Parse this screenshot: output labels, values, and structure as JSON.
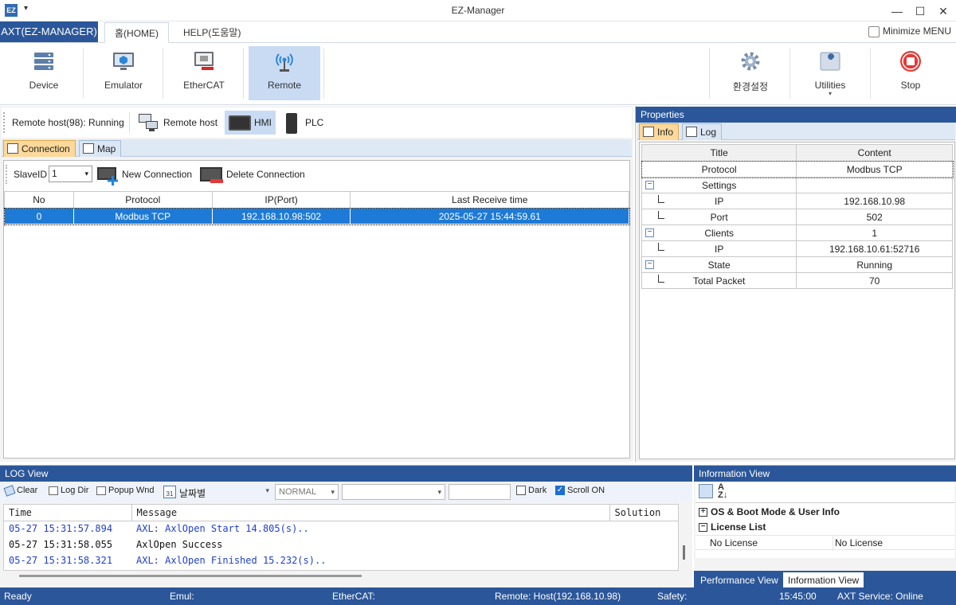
{
  "window": {
    "app_icon": "EZ",
    "title": "EZ-Manager",
    "minimize_glyph": "—",
    "maximize_glyph": "☐",
    "close_glyph": "✕"
  },
  "ribbon_tabs": {
    "app_menu": "AXT(EZ-MANAGER)",
    "home": "홈(HOME)",
    "help": "HELP(도움말)",
    "minimize_menu": "Minimize MENU"
  },
  "ribbon": {
    "device": "Device",
    "emulator": "Emulator",
    "ethercat": "EtherCAT",
    "remote": "Remote",
    "settings": "환경설정",
    "utilities": "Utilities",
    "stop": "Stop"
  },
  "remote_bar": {
    "status": "Remote host(98): Running",
    "remote_host": "Remote host",
    "hmi": "HMI",
    "plc": "PLC"
  },
  "panel_tabs": {
    "connection": "Connection",
    "map": "Map"
  },
  "connection": {
    "slave_label": "SlaveID",
    "slave_value": "1",
    "new_connection": "New Connection",
    "delete_connection": "Delete Connection",
    "columns": [
      "No",
      "Protocol",
      "IP(Port)",
      "Last Receive time"
    ],
    "rows": [
      [
        "0",
        "Modbus TCP",
        "192.168.10.98:502",
        "2025-05-27 15:44:59.61"
      ]
    ]
  },
  "properties": {
    "title": "Properties",
    "tab_info": "Info",
    "tab_log": "Log",
    "columns": [
      "Title",
      "Content"
    ],
    "rows": [
      {
        "title": "Protocol",
        "content": "Modbus TCP"
      },
      {
        "title": "Settings",
        "content": ""
      },
      {
        "title": "IP",
        "content": "192.168.10.98"
      },
      {
        "title": "Port",
        "content": "502"
      },
      {
        "title": "Clients",
        "content": "1"
      },
      {
        "title": "IP",
        "content": "192.168.10.61:52716"
      },
      {
        "title": "State",
        "content": "Running"
      },
      {
        "title": "Total Packet",
        "content": "70"
      }
    ]
  },
  "log_view": {
    "title": "LOG View",
    "clear": "Clear",
    "log_dir": "Log Dir",
    "popup": "Popup Wnd",
    "date_label": "날짜별",
    "calendar_day": "31",
    "level": "NORMAL",
    "dark": "Dark",
    "scroll_on": "Scroll ON",
    "columns": [
      "Time",
      "Message",
      "Solution"
    ],
    "entries": [
      {
        "time": "05-27 15:31:57.894",
        "message": "AXL: AxlOpen Start 14.805(s)..",
        "color": "#1f3fd0"
      },
      {
        "time": "05-27 15:31:58.055",
        "message": "AxlOpen Success",
        "color": "#111111"
      },
      {
        "time": "05-27 15:31:58.321",
        "message": "AXL: AxlOpen Finished 15.232(s)..",
        "color": "#1f3fd0"
      }
    ]
  },
  "info_view": {
    "title": "Information View",
    "sections": [
      "OS & Boot Mode & User Info",
      "License List"
    ],
    "license_row": [
      "No License",
      "No License"
    ],
    "tab_performance": "Performance View",
    "tab_information": "Information View"
  },
  "statusbar": {
    "ready": "Ready",
    "emul": "Emul:",
    "ethercat": "EtherCAT:",
    "remote": "Remote: Host(192.168.10.98)",
    "safety": "Safety:",
    "time": "15:45:00",
    "service": "AXT Service: Online"
  },
  "colors": {
    "accent": "#2b579a",
    "selection": "#1d7ad6",
    "stop": "#e53935"
  }
}
